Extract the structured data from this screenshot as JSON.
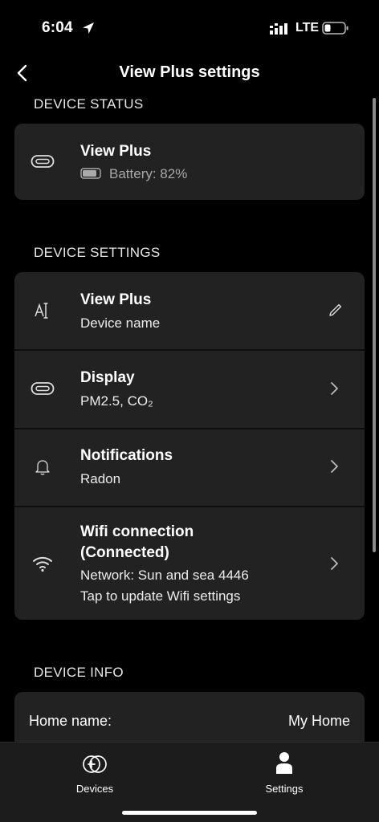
{
  "status_bar": {
    "time": "6:04",
    "network": "LTE"
  },
  "nav": {
    "title": "View Plus settings"
  },
  "device_status": {
    "header": "DEVICE STATUS",
    "device_name": "View Plus",
    "battery_text": "Battery: 82%",
    "battery_level": 0.82
  },
  "device_settings": {
    "header": "DEVICE SETTINGS",
    "rows": [
      {
        "title": "View Plus",
        "subtitle": "Device name",
        "icon": "text-rename-icon",
        "action": "pencil-icon"
      },
      {
        "title": "Display",
        "subtitle": "PM2.5, CO₂",
        "icon": "device-pill-icon",
        "action": "chevron-right-icon"
      },
      {
        "title": "Notifications",
        "subtitle": "Radon",
        "icon": "bell-icon",
        "action": "chevron-right-icon"
      },
      {
        "title_line1": "Wifi connection",
        "title_line2": "(Connected)",
        "subtitle_line1": "Network: Sun and sea 4446",
        "subtitle_line2": "Tap to update Wifi settings",
        "icon": "wifi-icon",
        "action": "chevron-right-icon"
      }
    ]
  },
  "device_info": {
    "header": "DEVICE INFO",
    "home_label": "Home name:",
    "home_value": "My Home"
  },
  "tabs": [
    {
      "label": "Devices",
      "icon": "devices-icon"
    },
    {
      "label": "Settings",
      "icon": "person-icon"
    }
  ]
}
